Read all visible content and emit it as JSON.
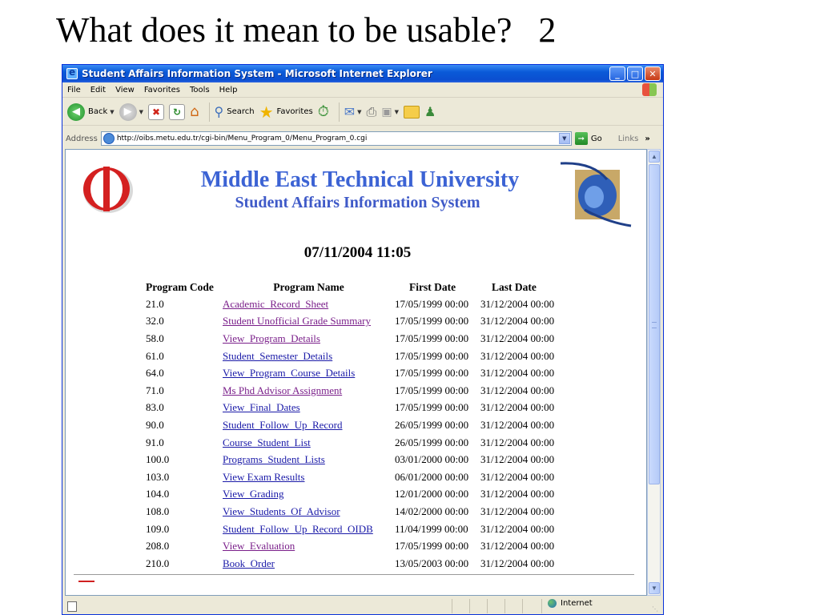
{
  "slide": {
    "title": "What does it mean to be usable?   2"
  },
  "window": {
    "title": "Student Affairs Information System - Microsoft Internet Explorer",
    "controls": {
      "minimize": "_",
      "maximize": "□",
      "close": "✕"
    }
  },
  "menubar": {
    "items": [
      {
        "label": "File"
      },
      {
        "label": "Edit"
      },
      {
        "label": "View"
      },
      {
        "label": "Favorites"
      },
      {
        "label": "Tools"
      },
      {
        "label": "Help"
      }
    ]
  },
  "toolbar": {
    "back_label": "Back",
    "search_label": "Search",
    "favorites_label": "Favorites"
  },
  "addressbar": {
    "label": "Address",
    "url": "http://oibs.metu.edu.tr/cgi-bin/Menu_Program_0/Menu_Program_0.cgi",
    "go_label": "Go",
    "links_label": "Links",
    "links_chevron": "»"
  },
  "page": {
    "university": "Middle East Technical University",
    "system": "Student Affairs Information System",
    "datetime": "07/11/2004 11:05",
    "columns": {
      "code": "Program Code",
      "name": "Program Name",
      "first": "First Date",
      "last": "Last Date"
    },
    "rows": [
      {
        "code": "21.0",
        "name": "Academic  Record  Sheet",
        "first": "17/05/1999 00:00",
        "last": "31/12/2004 00:00",
        "visited": true
      },
      {
        "code": "32.0",
        "name": "Student Unofficial Grade Summary",
        "first": "17/05/1999 00:00",
        "last": "31/12/2004 00:00",
        "visited": true
      },
      {
        "code": "58.0",
        "name": "View  Program  Details",
        "first": "17/05/1999 00:00",
        "last": "31/12/2004 00:00",
        "visited": true
      },
      {
        "code": "61.0",
        "name": "Student  Semester  Details",
        "first": "17/05/1999 00:00",
        "last": "31/12/2004 00:00",
        "visited": false
      },
      {
        "code": "64.0",
        "name": "View  Program  Course  Details",
        "first": "17/05/1999 00:00",
        "last": "31/12/2004 00:00",
        "visited": false
      },
      {
        "code": "71.0",
        "name": "Ms Phd Advisor Assignment",
        "first": "17/05/1999 00:00",
        "last": "31/12/2004 00:00",
        "visited": true
      },
      {
        "code": "83.0",
        "name": "View  Final  Dates",
        "first": "17/05/1999 00:00",
        "last": "31/12/2004 00:00",
        "visited": false
      },
      {
        "code": "90.0",
        "name": "Student  Follow  Up  Record",
        "first": "26/05/1999 00:00",
        "last": "31/12/2004 00:00",
        "visited": false
      },
      {
        "code": "91.0",
        "name": "Course  Student  List",
        "first": "26/05/1999 00:00",
        "last": "31/12/2004 00:00",
        "visited": false
      },
      {
        "code": "100.0",
        "name": "Programs  Student  Lists",
        "first": "03/01/2000 00:00",
        "last": "31/12/2004 00:00",
        "visited": false
      },
      {
        "code": "103.0",
        "name": "View Exam Results",
        "first": "06/01/2000 00:00",
        "last": "31/12/2004 00:00",
        "visited": false
      },
      {
        "code": "104.0",
        "name": "View  Grading",
        "first": "12/01/2000 00:00",
        "last": "31/12/2004 00:00",
        "visited": false
      },
      {
        "code": "108.0",
        "name": "View  Students  Of  Advisor",
        "first": "14/02/2000 00:00",
        "last": "31/12/2004 00:00",
        "visited": false
      },
      {
        "code": "109.0",
        "name": "Student  Follow  Up  Record  OIDB",
        "first": "11/04/1999 00:00",
        "last": "31/12/2004 00:00",
        "visited": false
      },
      {
        "code": "208.0",
        "name": "View  Evaluation",
        "first": "17/05/1999 00:00",
        "last": "31/12/2004 00:00",
        "visited": true
      },
      {
        "code": "210.0",
        "name": "Book  Order",
        "first": "13/05/2003 00:00",
        "last": "31/12/2004 00:00",
        "visited": false
      }
    ]
  },
  "statusbar": {
    "zone": "Internet"
  },
  "colors": {
    "link": "#1a1aa8",
    "visited": "#7a1f8a",
    "header_blue": "#3c63d4"
  }
}
